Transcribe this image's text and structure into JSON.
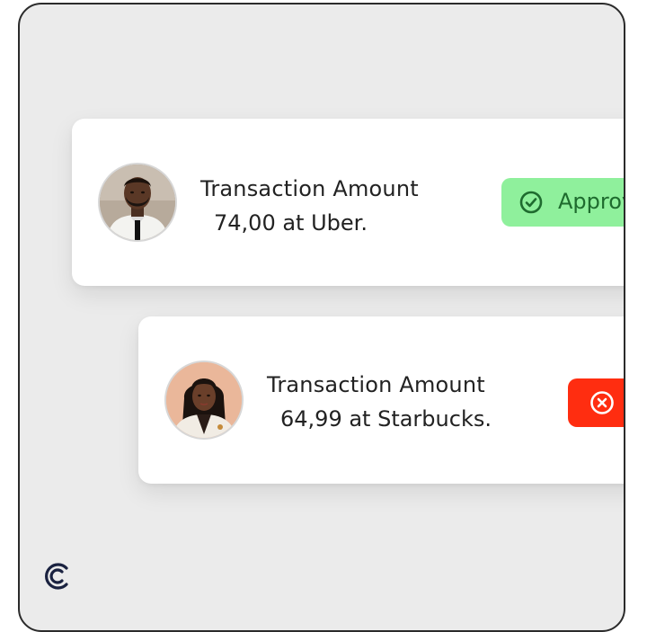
{
  "transactions": [
    {
      "title": "Transaction Amount",
      "detail": "74,00 at Uber.",
      "status": "approved",
      "status_label": "Approv",
      "avatar_icon": "person-avatar-man",
      "status_icon": "check-circle-icon",
      "status_color": "#8ff09c"
    },
    {
      "title": "Transaction Amount",
      "detail": "64,99 at Starbucks.",
      "status": "declined",
      "status_label": "",
      "avatar_icon": "person-avatar-woman",
      "status_icon": "x-circle-icon",
      "status_color": "#ff2d10"
    }
  ],
  "brand": {
    "logo_icon": "c-logo-icon",
    "color": "#1a2240"
  }
}
